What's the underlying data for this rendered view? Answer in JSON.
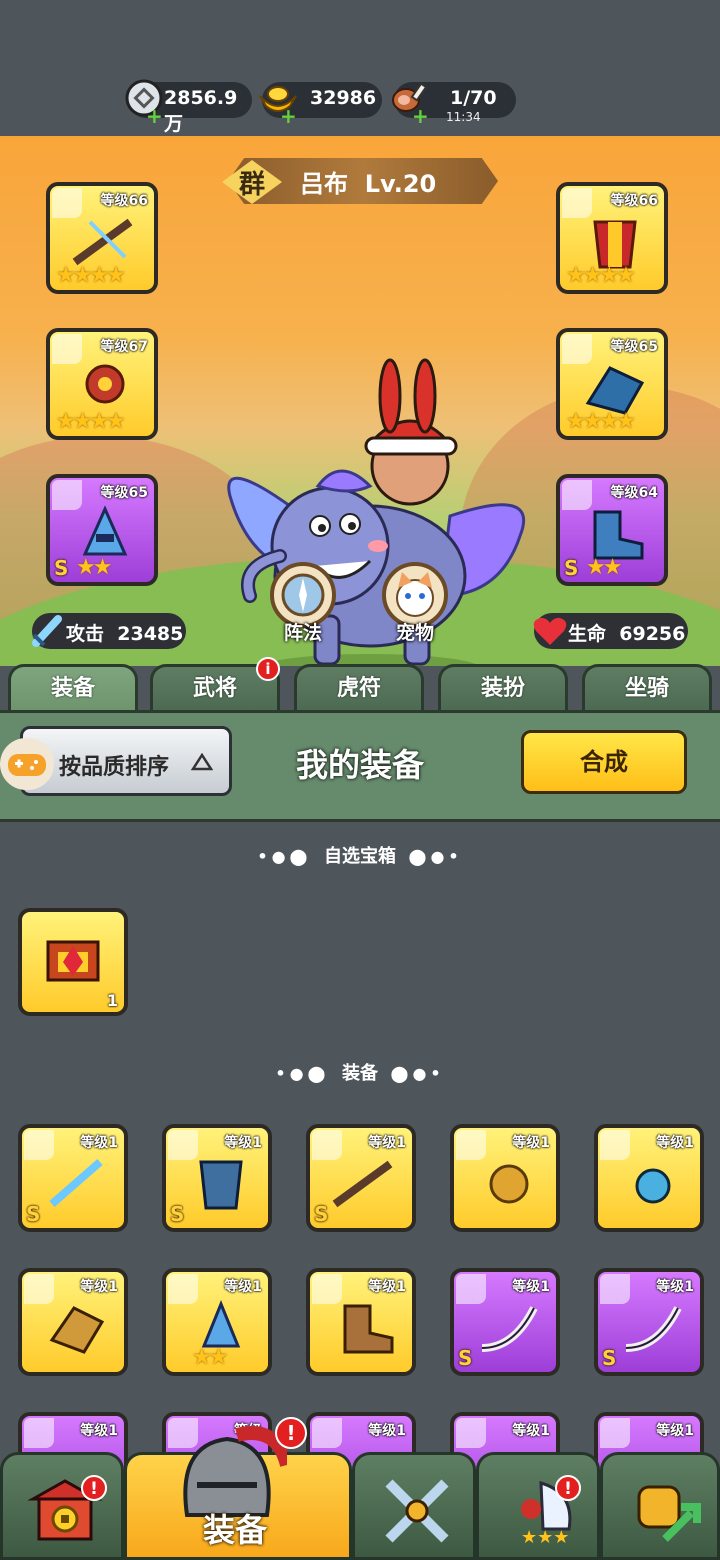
{
  "resources": {
    "silver": {
      "value": "2856.9万"
    },
    "gold": {
      "value": "32986"
    },
    "stamina": {
      "value": "1/70",
      "timer": "11:34"
    }
  },
  "hero": {
    "faction": "群",
    "name": "吕布",
    "level": "Lv.20",
    "attack_label": "攻击",
    "attack_value": "23485",
    "hp_label": "生命",
    "hp_value": "69256",
    "formation_label": "阵法",
    "pet_label": "宠物"
  },
  "equipped": {
    "left": [
      {
        "level": "等级66",
        "stars": "★★★★",
        "grade": ""
      },
      {
        "level": "等级67",
        "stars": "★★★★",
        "grade": ""
      },
      {
        "level": "等级65",
        "stars": "★★",
        "grade": "S"
      }
    ],
    "right": [
      {
        "level": "等级66",
        "stars": "★★★★",
        "grade": ""
      },
      {
        "level": "等级65",
        "stars": "★★★★",
        "grade": ""
      },
      {
        "level": "等级64",
        "stars": "★★",
        "grade": "S"
      }
    ]
  },
  "tabs": [
    "装备",
    "武将",
    "虎符",
    "装扮",
    "坐骑"
  ],
  "toolbar": {
    "sort_label": "按品质排序",
    "title": "我的装备",
    "synth_label": "合成"
  },
  "sections": {
    "chest_title": "自选宝箱",
    "equip_title": "装备"
  },
  "chest": {
    "count": "1"
  },
  "inventory": {
    "row1": [
      {
        "level": "等级1",
        "grade": "S",
        "stars": ""
      },
      {
        "level": "等级1",
        "grade": "S",
        "stars": ""
      },
      {
        "level": "等级1",
        "grade": "S",
        "stars": ""
      },
      {
        "level": "等级1",
        "grade": "",
        "stars": ""
      },
      {
        "level": "等级1",
        "grade": "",
        "stars": ""
      }
    ],
    "row2": [
      {
        "level": "等级1",
        "grade": "",
        "stars": ""
      },
      {
        "level": "等级1",
        "grade": "",
        "stars": "★★"
      },
      {
        "level": "等级1",
        "grade": "",
        "stars": ""
      },
      {
        "level": "等级1",
        "grade": "S",
        "stars": ""
      },
      {
        "level": "等级1",
        "grade": "S",
        "stars": ""
      }
    ],
    "row3": [
      {
        "level": "等级1"
      },
      {
        "level": "等级"
      },
      {
        "level": "等级1"
      },
      {
        "level": "等级1"
      },
      {
        "level": "等级1"
      }
    ]
  },
  "bottom_nav": {
    "equip_label": "装备",
    "badge": "!"
  },
  "colors": {
    "gold_slot": "#ffcb2b",
    "purple_slot": "#9d3fd8",
    "accent_green": "#668a6c"
  }
}
